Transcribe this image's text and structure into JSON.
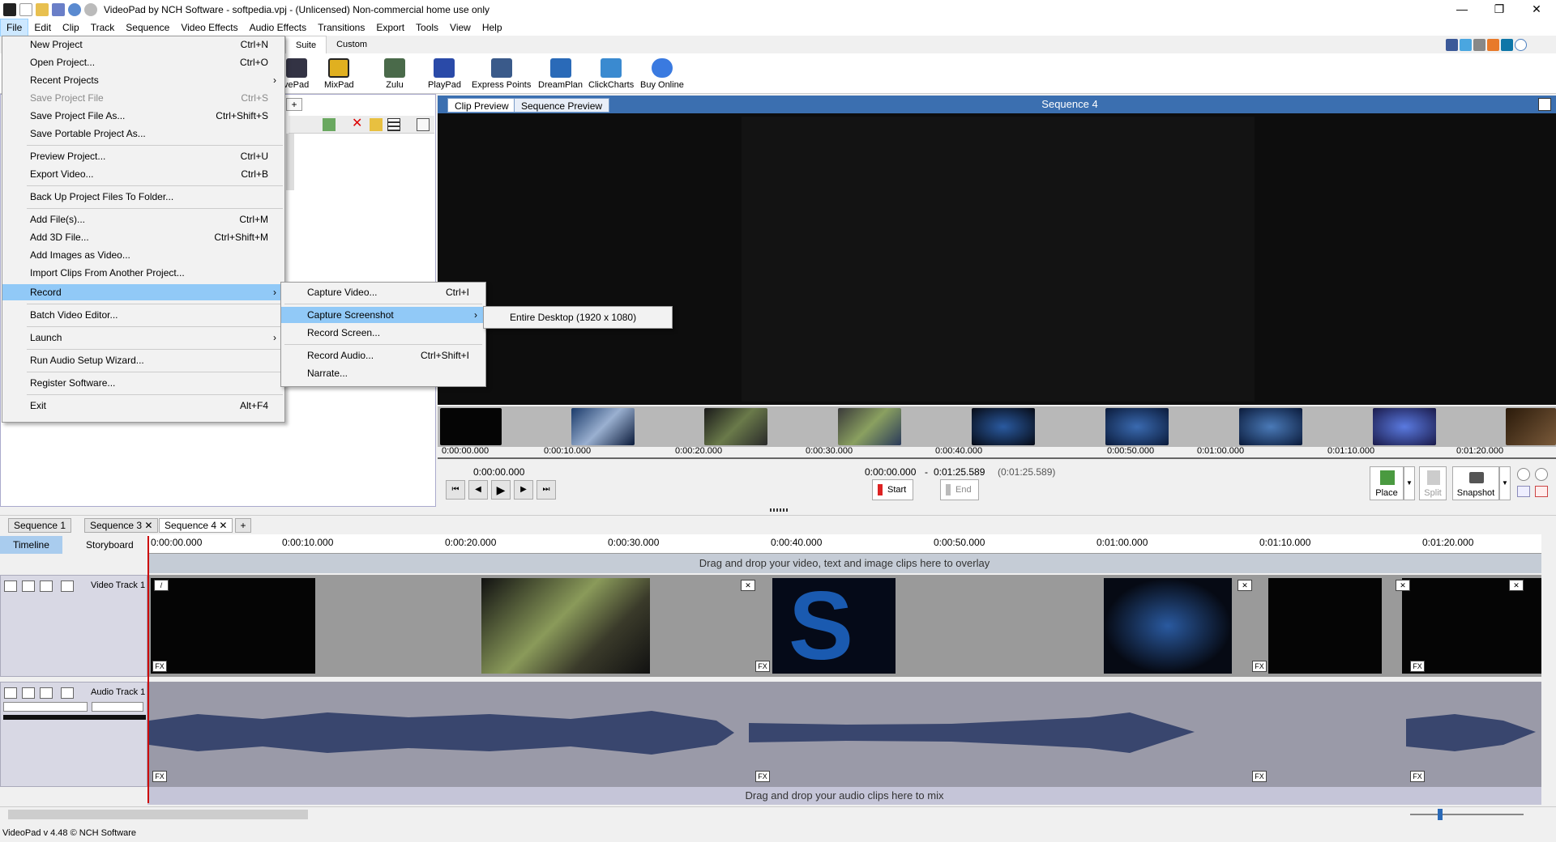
{
  "app": {
    "title": "VideoPad by NCH Software - softpedia.vpj - (Unlicensed) Non-commercial home use only",
    "status": "VideoPad v 4.48 © NCH Software"
  },
  "menubar": [
    "File",
    "Edit",
    "Clip",
    "Track",
    "Sequence",
    "Video Effects",
    "Audio Effects",
    "Transitions",
    "Export",
    "Tools",
    "View",
    "Help"
  ],
  "ribbon": {
    "tabs": [
      "Suite",
      "Custom"
    ],
    "buttons": [
      "vePad",
      "MixPad",
      "Zulu",
      "PlayPad",
      "Express Points",
      "DreamPlan",
      "ClickCharts",
      "Buy Online"
    ]
  },
  "file_menu": {
    "items": [
      {
        "label": "New Project",
        "shortcut": "Ctrl+N"
      },
      {
        "label": "Open Project...",
        "shortcut": "Ctrl+O"
      },
      {
        "label": "Recent Projects",
        "shortcut": ""
      },
      {
        "label": "Save Project File",
        "shortcut": "Ctrl+S"
      },
      {
        "label": "Save Project File As...",
        "shortcut": "Ctrl+Shift+S"
      },
      {
        "label": "Save Portable Project As...",
        "shortcut": ""
      },
      {
        "label": "Preview Project...",
        "shortcut": "Ctrl+U"
      },
      {
        "label": "Export Video...",
        "shortcut": "Ctrl+B"
      },
      {
        "label": "Back Up Project Files To Folder...",
        "shortcut": ""
      },
      {
        "label": "Add File(s)...",
        "shortcut": "Ctrl+M"
      },
      {
        "label": "Add 3D File...",
        "shortcut": "Ctrl+Shift+M"
      },
      {
        "label": "Add Images as Video...",
        "shortcut": ""
      },
      {
        "label": "Import Clips From Another Project...",
        "shortcut": ""
      },
      {
        "label": "Record",
        "shortcut": ""
      },
      {
        "label": "Batch Video Editor...",
        "shortcut": ""
      },
      {
        "label": "Launch",
        "shortcut": ""
      },
      {
        "label": "Run Audio Setup Wizard...",
        "shortcut": ""
      },
      {
        "label": "Register Software...",
        "shortcut": ""
      },
      {
        "label": "Exit",
        "shortcut": "Alt+F4"
      }
    ]
  },
  "record_menu": {
    "items": [
      {
        "label": "Capture Video...",
        "shortcut": "Ctrl+I"
      },
      {
        "label": "Capture Screenshot",
        "shortcut": ""
      },
      {
        "label": "Record Screen...",
        "shortcut": ""
      },
      {
        "label": "Record Audio...",
        "shortcut": "Ctrl+Shift+I"
      },
      {
        "label": "Narrate...",
        "shortcut": ""
      }
    ]
  },
  "screenshot_menu": {
    "items": [
      "Entire Desktop (1920 x 1080)"
    ]
  },
  "preview": {
    "tabs": [
      "Clip Preview",
      "Sequence Preview"
    ],
    "title": "Sequence 4",
    "strip_times": [
      "0:00:00.000",
      "0:00:10.000",
      "0:00:20.000",
      "0:00:30.000",
      "0:00:40.000",
      "0:00:50.000",
      "0:01:00.000",
      "0:01:10.000",
      "0:01:20.000"
    ],
    "current_time": "0:00:00.000",
    "range_start": "0:00:00.000",
    "range_sep": "-",
    "range_end": "0:01:25.589",
    "duration": "(0:01:25.589)",
    "start_label": "Start",
    "end_label": "End",
    "place_label": "Place",
    "split_label": "Split",
    "snapshot_label": "Snapshot"
  },
  "sequence_tabs": [
    "Sequence 1",
    "Sequence 3",
    "Sequence 4"
  ],
  "timeline": {
    "views": [
      "Timeline",
      "Storyboard"
    ],
    "ruler": [
      "0:00:00.000",
      "0:00:10.000",
      "0:00:20.000",
      "0:00:30.000",
      "0:00:40.000",
      "0:00:50.000",
      "0:01:00.000",
      "0:01:10.000",
      "0:01:20.000"
    ],
    "overlay_hint": "Drag and drop your video, text and image clips here to overlay",
    "video_track": "Video Track 1",
    "audio_track": "Audio Track 1",
    "audio_hint": "Drag and drop your audio clips here to mix"
  }
}
